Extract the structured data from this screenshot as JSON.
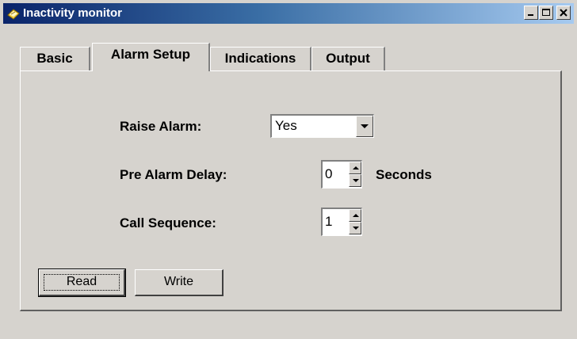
{
  "window": {
    "title": "Inactivity monitor",
    "icon": "folder-note-icon",
    "controls": {
      "minimize": "minimize-icon",
      "maximize": "maximize-icon",
      "close": "close-icon"
    },
    "title_gradient": [
      "#0a246a",
      "#a6caf0"
    ]
  },
  "tabs": [
    {
      "label": "Basic",
      "active": false
    },
    {
      "label": "Alarm Setup",
      "active": true
    },
    {
      "label": "Indications",
      "active": false
    },
    {
      "label": "Output",
      "active": false
    }
  ],
  "form": {
    "raise_alarm": {
      "label": "Raise Alarm:",
      "value": "Yes"
    },
    "pre_alarm_delay": {
      "label": "Pre Alarm Delay:",
      "value": "0",
      "unit": "Seconds"
    },
    "call_sequence": {
      "label": "Call Sequence:",
      "value": "1"
    }
  },
  "buttons": {
    "read": "Read",
    "write": "Write"
  },
  "colors": {
    "face": "#d6d3ce",
    "shadow": "#808080",
    "highlight": "#ffffff"
  }
}
